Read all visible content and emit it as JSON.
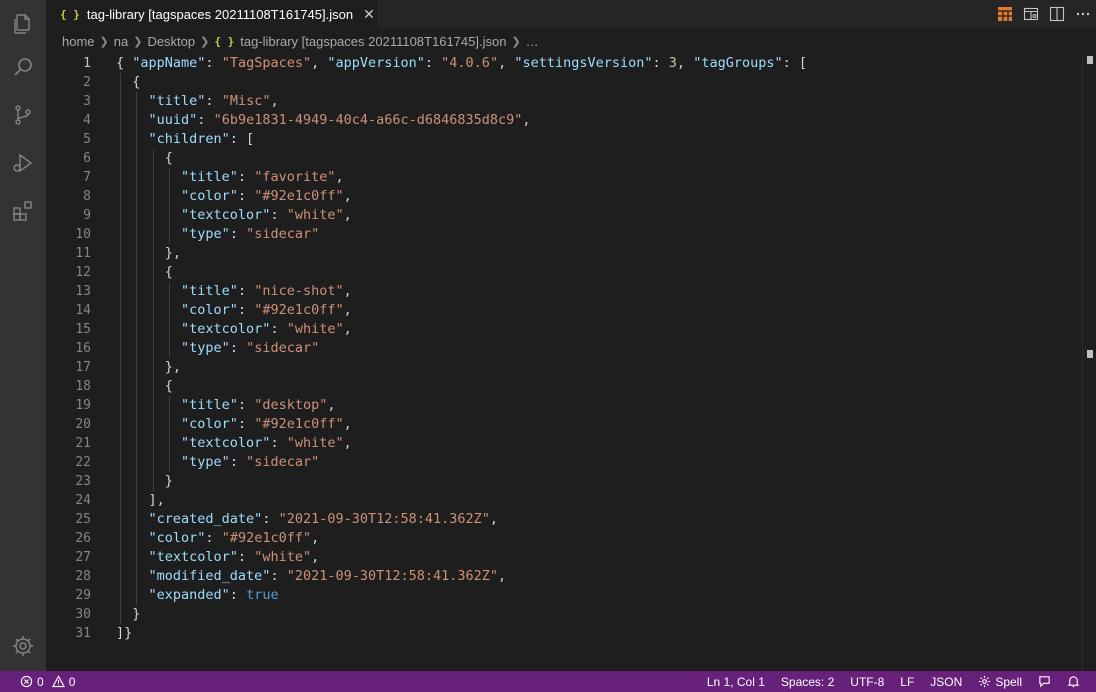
{
  "activity_bar": {
    "items": [
      {
        "icon": "files-icon"
      },
      {
        "icon": "search-icon"
      },
      {
        "icon": "source-control-icon"
      },
      {
        "icon": "run-debug-icon"
      },
      {
        "icon": "extensions-icon"
      }
    ],
    "bottom": {
      "icon": "gear-icon"
    }
  },
  "tab": {
    "icon_text": "{ }",
    "label": "tag-library [tagspaces 20211108T161745].json",
    "close": "✕"
  },
  "breadcrumb": {
    "items": [
      "home",
      "na",
      "Desktop"
    ],
    "file_icon": "{ }",
    "file": "tag-library [tagspaces 20211108T161745].json",
    "trail": "…"
  },
  "editor": {
    "active_line": 1,
    "line_numbers": [
      "1",
      "2",
      "3",
      "4",
      "5",
      "6",
      "7",
      "8",
      "9",
      "10",
      "11",
      "12",
      "13",
      "14",
      "15",
      "16",
      "17",
      "18",
      "19",
      "20",
      "21",
      "22",
      "23",
      "24",
      "25",
      "26",
      "27",
      "28",
      "29",
      "30",
      "31"
    ],
    "lines": [
      [
        [
          "p",
          "{ "
        ],
        [
          "k",
          "\"appName\""
        ],
        [
          "p",
          ": "
        ],
        [
          "s",
          "\"TagSpaces\""
        ],
        [
          "p",
          ", "
        ],
        [
          "k",
          "\"appVersion\""
        ],
        [
          "p",
          ": "
        ],
        [
          "s",
          "\"4.0.6\""
        ],
        [
          "p",
          ", "
        ],
        [
          "k",
          "\"settingsVersion\""
        ],
        [
          "p",
          ": "
        ],
        [
          "n",
          "3"
        ],
        [
          "p",
          ", "
        ],
        [
          "k",
          "\"tagGroups\""
        ],
        [
          "p",
          ": ["
        ]
      ],
      [
        [
          "p",
          "  {"
        ]
      ],
      [
        [
          "p",
          "    "
        ],
        [
          "k",
          "\"title\""
        ],
        [
          "p",
          ": "
        ],
        [
          "s",
          "\"Misc\""
        ],
        [
          "p",
          ","
        ]
      ],
      [
        [
          "p",
          "    "
        ],
        [
          "k",
          "\"uuid\""
        ],
        [
          "p",
          ": "
        ],
        [
          "s",
          "\"6b9e1831-4949-40c4-a66c-d6846835d8c9\""
        ],
        [
          "p",
          ","
        ]
      ],
      [
        [
          "p",
          "    "
        ],
        [
          "k",
          "\"children\""
        ],
        [
          "p",
          ": ["
        ]
      ],
      [
        [
          "p",
          "      {"
        ]
      ],
      [
        [
          "p",
          "        "
        ],
        [
          "k",
          "\"title\""
        ],
        [
          "p",
          ": "
        ],
        [
          "s",
          "\"favorite\""
        ],
        [
          "p",
          ","
        ]
      ],
      [
        [
          "p",
          "        "
        ],
        [
          "k",
          "\"color\""
        ],
        [
          "p",
          ": "
        ],
        [
          "s",
          "\"#92e1c0ff\""
        ],
        [
          "p",
          ","
        ]
      ],
      [
        [
          "p",
          "        "
        ],
        [
          "k",
          "\"textcolor\""
        ],
        [
          "p",
          ": "
        ],
        [
          "s",
          "\"white\""
        ],
        [
          "p",
          ","
        ]
      ],
      [
        [
          "p",
          "        "
        ],
        [
          "k",
          "\"type\""
        ],
        [
          "p",
          ": "
        ],
        [
          "s",
          "\"sidecar\""
        ]
      ],
      [
        [
          "p",
          "      },"
        ]
      ],
      [
        [
          "p",
          "      {"
        ]
      ],
      [
        [
          "p",
          "        "
        ],
        [
          "k",
          "\"title\""
        ],
        [
          "p",
          ": "
        ],
        [
          "s",
          "\"nice-shot\""
        ],
        [
          "p",
          ","
        ]
      ],
      [
        [
          "p",
          "        "
        ],
        [
          "k",
          "\"color\""
        ],
        [
          "p",
          ": "
        ],
        [
          "s",
          "\"#92e1c0ff\""
        ],
        [
          "p",
          ","
        ]
      ],
      [
        [
          "p",
          "        "
        ],
        [
          "k",
          "\"textcolor\""
        ],
        [
          "p",
          ": "
        ],
        [
          "s",
          "\"white\""
        ],
        [
          "p",
          ","
        ]
      ],
      [
        [
          "p",
          "        "
        ],
        [
          "k",
          "\"type\""
        ],
        [
          "p",
          ": "
        ],
        [
          "s",
          "\"sidecar\""
        ]
      ],
      [
        [
          "p",
          "      },"
        ]
      ],
      [
        [
          "p",
          "      {"
        ]
      ],
      [
        [
          "p",
          "        "
        ],
        [
          "k",
          "\"title\""
        ],
        [
          "p",
          ": "
        ],
        [
          "s",
          "\"desktop\""
        ],
        [
          "p",
          ","
        ]
      ],
      [
        [
          "p",
          "        "
        ],
        [
          "k",
          "\"color\""
        ],
        [
          "p",
          ": "
        ],
        [
          "s",
          "\"#92e1c0ff\""
        ],
        [
          "p",
          ","
        ]
      ],
      [
        [
          "p",
          "        "
        ],
        [
          "k",
          "\"textcolor\""
        ],
        [
          "p",
          ": "
        ],
        [
          "s",
          "\"white\""
        ],
        [
          "p",
          ","
        ]
      ],
      [
        [
          "p",
          "        "
        ],
        [
          "k",
          "\"type\""
        ],
        [
          "p",
          ": "
        ],
        [
          "s",
          "\"sidecar\""
        ]
      ],
      [
        [
          "p",
          "      }"
        ]
      ],
      [
        [
          "p",
          "    ],"
        ]
      ],
      [
        [
          "p",
          "    "
        ],
        [
          "k",
          "\"created_date\""
        ],
        [
          "p",
          ": "
        ],
        [
          "s",
          "\"2021-09-30T12:58:41.362Z\""
        ],
        [
          "p",
          ","
        ]
      ],
      [
        [
          "p",
          "    "
        ],
        [
          "k",
          "\"color\""
        ],
        [
          "p",
          ": "
        ],
        [
          "s",
          "\"#92e1c0ff\""
        ],
        [
          "p",
          ","
        ]
      ],
      [
        [
          "p",
          "    "
        ],
        [
          "k",
          "\"textcolor\""
        ],
        [
          "p",
          ": "
        ],
        [
          "s",
          "\"white\""
        ],
        [
          "p",
          ","
        ]
      ],
      [
        [
          "p",
          "    "
        ],
        [
          "k",
          "\"modified_date\""
        ],
        [
          "p",
          ": "
        ],
        [
          "s",
          "\"2021-09-30T12:58:41.362Z\""
        ],
        [
          "p",
          ","
        ]
      ],
      [
        [
          "p",
          "    "
        ],
        [
          "k",
          "\"expanded\""
        ],
        [
          "p",
          ": "
        ],
        [
          "b",
          "true"
        ]
      ],
      [
        [
          "p",
          "  }"
        ]
      ],
      [
        [
          "p",
          "]}"
        ]
      ]
    ]
  },
  "status_bar": {
    "errors": "0",
    "warnings": "0",
    "position": "Ln 1, Col 1",
    "spaces": "Spaces: 2",
    "encoding": "UTF-8",
    "eol": "LF",
    "language": "JSON",
    "spell": "Spell"
  },
  "colors": {
    "status_bar": "#68217a",
    "activity_bar": "#333333",
    "editor_bg": "#1e1e1e",
    "json_key": "#9cdcfe",
    "json_string": "#ce9178",
    "json_number": "#b5cea8",
    "json_bool": "#569cd6"
  }
}
